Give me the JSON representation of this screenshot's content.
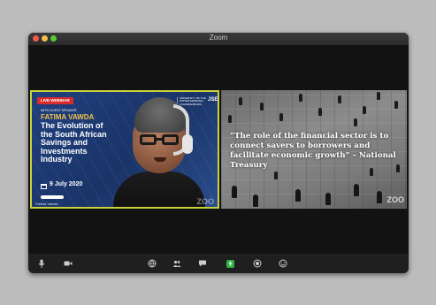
{
  "window": {
    "title": "Zoom"
  },
  "left_tile": {
    "live_badge": "LIVE WEBINAR",
    "speaker_label": "WITH GUEST SPEAKER",
    "speaker_name": "FATIMA VAWDA",
    "webinar_title": "The Evolution of the South African Savings and Investments Industry",
    "date": "9 July 2020",
    "university_logo": "UNIVERSITY OF THE WITWATERSRAND, JOHANNESBURG",
    "jse_logo": "JSE",
    "participant_name": "Fatima Vawda",
    "watermark": "ZOO"
  },
  "right_tile": {
    "quote": "“The role of the financial sector is to connect savers to borrowers and facilitate economic growth” – National Treasury",
    "watermark": "ZOO"
  },
  "toolbar": {
    "buttons": [
      "mic-icon",
      "video-icon",
      "security-icon",
      "participants-icon",
      "chat-icon",
      "share-screen-icon",
      "record-icon",
      "reactions-icon"
    ]
  },
  "colors": {
    "active_border": "#c9d23a",
    "share_green": "#2fb344",
    "close": "#ee5a52",
    "minimize": "#f5be4f",
    "maximize": "#59c837"
  }
}
